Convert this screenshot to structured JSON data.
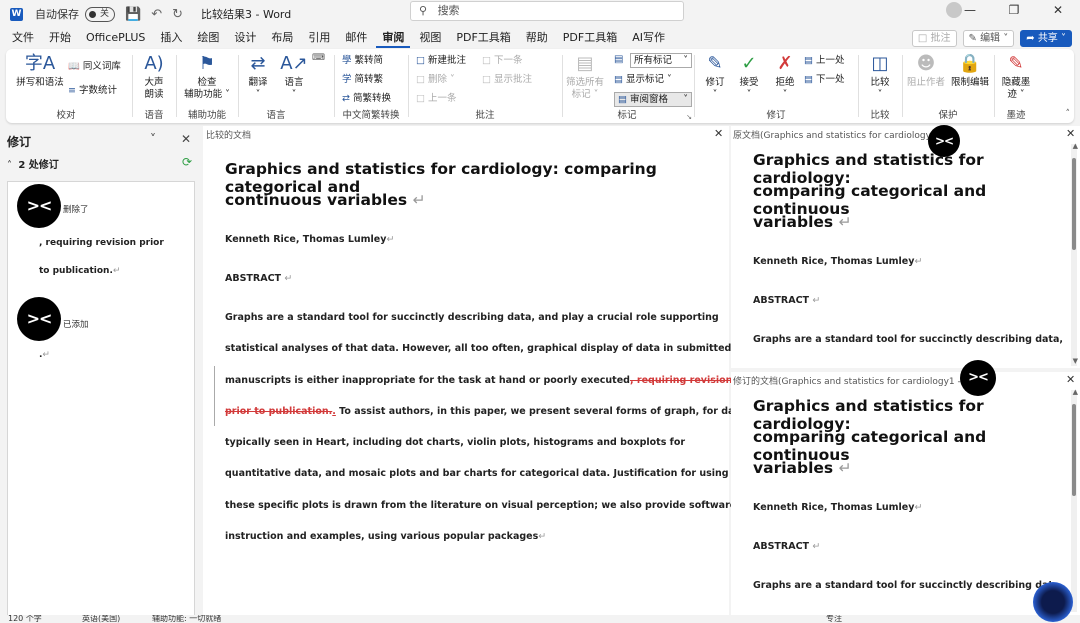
{
  "titlebar": {
    "autosave_label": "自动保存",
    "autosave_state": "关",
    "doc_title": "比较结果3  -  Word",
    "search_placeholder": "搜索"
  },
  "menu": {
    "tabs": [
      "文件",
      "开始",
      "OfficePLUS",
      "插入",
      "绘图",
      "设计",
      "布局",
      "引用",
      "邮件",
      "审阅",
      "视图",
      "PDF工具箱",
      "帮助",
      "PDF工具箱",
      "AI写作"
    ],
    "comment_btn": "批注",
    "edit_btn": "编辑",
    "share_btn": "共享"
  },
  "ribbon": {
    "proof": {
      "spell": "拼写和语法",
      "thesaurus": "同义词库",
      "wordcount": "字数统计",
      "label": "校对"
    },
    "speech": {
      "read_aloud_1": "大声",
      "read_aloud_2": "朗读",
      "label": "语音"
    },
    "access": {
      "check_1": "检查",
      "check_2": "辅助功能",
      "label": "辅助功能"
    },
    "lang": {
      "translate": "翻译",
      "language": "语言",
      "label": "语言"
    },
    "chinese": {
      "to_simp": "繁转简",
      "to_trad": "简转繁",
      "convert": "简繁转换",
      "label": "中文简繁转换"
    },
    "comments": {
      "new": "新建批注",
      "delete": "删除",
      "prev": "上一条",
      "next": "下一条",
      "show": "显示批注",
      "label": "批注"
    },
    "markup": {
      "filter_1": "筛选所有",
      "filter_2": "标记",
      "all_markup": "所有标记",
      "show_markup": "显示标记",
      "review_pane": "审阅窗格",
      "label": "标记"
    },
    "changes": {
      "track": "修订",
      "accept": "接受",
      "reject": "拒绝",
      "prev": "上一处",
      "next": "下一处",
      "label": "修订"
    },
    "compare": {
      "compare": "比较",
      "label": "比较"
    },
    "protect": {
      "block": "阻止作者",
      "restrict": "限制编辑",
      "label": "保护"
    },
    "ink": {
      "hide_1": "隐藏墨",
      "hide_2": "迹",
      "label": "墨迹"
    }
  },
  "revisions_pane": {
    "title": "修订",
    "count": "2 处修订",
    "items": [
      {
        "kind": "删除了",
        "text_1": ", requiring revision prior",
        "text_2": "to publication."
      },
      {
        "kind": "已添加",
        "text_1": "."
      }
    ]
  },
  "compared_doc": {
    "pane_title": "比较的文档",
    "title_line1": "Graphics and statistics for cardiology: comparing categorical and",
    "title_line2": "continuous variables",
    "authors": "Kenneth Rice, Thomas Lumley",
    "abstract_heading": "ABSTRACT",
    "lines": [
      "Graphs are a standard tool for succinctly describing data, and play a crucial role supporting",
      "statistical analyses of that data. However, all too often, graphical display of data in submitted",
      "manuscripts is either inappropriate for the task at hand or poorly executed",
      ", requiring revision",
      "prior to publication.",
      ".",
      " To assist authors, in this paper, we present several forms of graph, for data",
      "typically seen in Heart, including dot charts, violin plots, histograms and boxplots for",
      "quantitative data, and mosaic plots and bar charts for categorical data. Justification for using",
      "these specific plots is drawn from the literature on visual perception; we also provide software",
      "instruction and examples, using various popular packages"
    ]
  },
  "original_doc": {
    "pane_title": "原文档(Graphics and statistics for cardiology - 5",
    "title_line1": "Graphics and statistics for cardiology:",
    "title_line2": "comparing categorical and continuous",
    "title_line3": "variables",
    "authors": "Kenneth Rice, Thomas Lumley",
    "abstract_heading": "ABSTRACT",
    "first_line": "Graphs are a standard tool for succinctly describing data,"
  },
  "revised_doc": {
    "pane_title": "修订的文档(Graphics and statistics for cardiology1 - 子",
    "title_line1": "Graphics and statistics for cardiology:",
    "title_line2": "comparing categorical and continuous",
    "title_line3": "variables",
    "authors": "Kenneth Rice, Thomas Lumley",
    "abstract_heading": "ABSTRACT",
    "first_line": "Graphs are a standard tool for succinctly describing data,"
  },
  "statusbar": {
    "words": "120 个字",
    "lang": "英语(美国)",
    "access": "辅助功能: 一切就绪",
    "focus": "专注"
  },
  "colors": {
    "accent": "#185abd",
    "deleted": "#d23a3a",
    "refresh": "#2e9e44"
  }
}
